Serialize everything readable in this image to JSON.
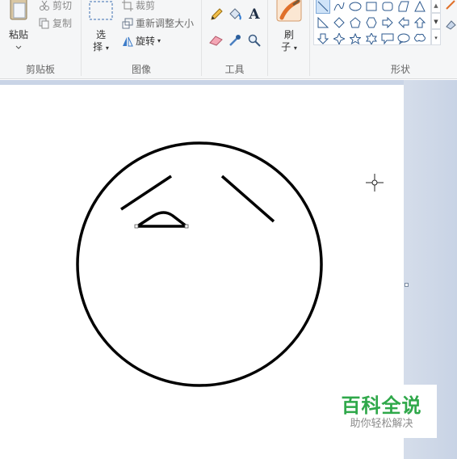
{
  "clipboard": {
    "paste_label": "粘贴",
    "cut_label": "剪切",
    "copy_label": "复制",
    "group_label": "剪贴板"
  },
  "image": {
    "select_label_1": "选",
    "select_label_2": "择",
    "crop_label": "裁剪",
    "resize_label": "重新调整大小",
    "rotate_label": "旋转",
    "group_label": "图像"
  },
  "tools": {
    "text_tool_glyph": "A",
    "group_label": "工具"
  },
  "brushes": {
    "label_1": "刷",
    "label_2": "子"
  },
  "shapes": {
    "group_label": "形状"
  },
  "watermark": {
    "title": "百科全说",
    "subtitle": "助你轻松解决"
  },
  "colors": {
    "ribbon_bg": "#f5f6f7",
    "workspace_bg": "#c9d4e6",
    "canvas_bg": "#ffffff",
    "stroke": "#000000",
    "watermark_green": "#2fa84a"
  }
}
